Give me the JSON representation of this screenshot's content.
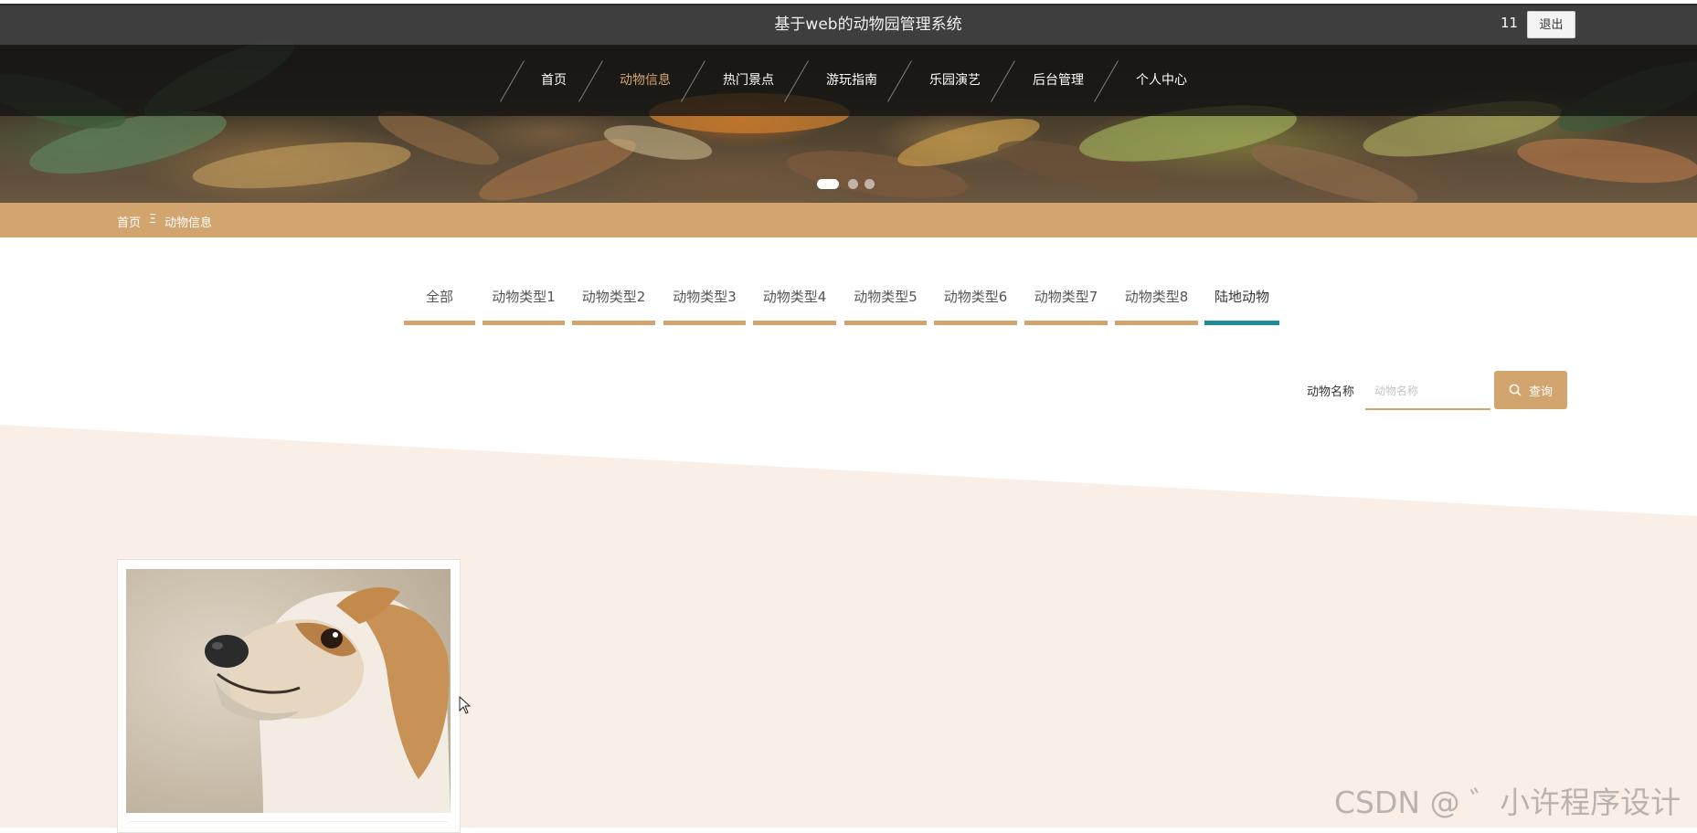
{
  "header": {
    "title": "基于web的动物园管理系统",
    "user_name": "11",
    "logout_label": "退出"
  },
  "nav": {
    "items": [
      {
        "label": "首页",
        "active": false
      },
      {
        "label": "动物信息",
        "active": true
      },
      {
        "label": "热门景点",
        "active": false
      },
      {
        "label": "游玩指南",
        "active": false
      },
      {
        "label": "乐园演艺",
        "active": false
      },
      {
        "label": "后台管理",
        "active": false
      },
      {
        "label": "个人中心",
        "active": false
      }
    ]
  },
  "carousel": {
    "slide_count": 3,
    "active_index": 0
  },
  "breadcrumb": {
    "home": "首页",
    "separator": "Ξ",
    "current": "动物信息"
  },
  "category_tabs": [
    {
      "label": "全部",
      "active": false
    },
    {
      "label": "动物类型1",
      "active": false
    },
    {
      "label": "动物类型2",
      "active": false
    },
    {
      "label": "动物类型3",
      "active": false
    },
    {
      "label": "动物类型4",
      "active": false
    },
    {
      "label": "动物类型5",
      "active": false
    },
    {
      "label": "动物类型6",
      "active": false
    },
    {
      "label": "动物类型7",
      "active": false
    },
    {
      "label": "动物类型8",
      "active": false
    },
    {
      "label": "陆地动物",
      "active": true
    }
  ],
  "search": {
    "label": "动物名称",
    "placeholder": "动物名称",
    "value": "",
    "button_label": "查询",
    "button_icon": "search-icon"
  },
  "results": [
    {
      "image": "dog-photo",
      "title": ""
    }
  ],
  "colors": {
    "accent": "#d3a56e",
    "active_tab": "#1f8a98",
    "header_bg": "#404040",
    "section_bg": "#faefe7"
  },
  "watermark": "CSDN @ ゛小许程序设计"
}
